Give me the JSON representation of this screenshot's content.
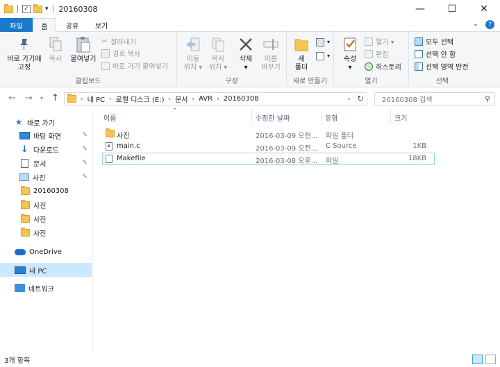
{
  "window": {
    "title": "20160308",
    "controls": [
      "—",
      "☐",
      "✕"
    ]
  },
  "tabs": {
    "file": "파일",
    "home": "홈",
    "share": "공유",
    "view": "보기"
  },
  "ribbon": {
    "clipboard": {
      "label": "클립보드",
      "pin_quick_access": "바로 가기에\n고정",
      "copy": "복사",
      "paste": "붙여넣기",
      "cut": "잘라내기",
      "copy_path": "경로 복사",
      "paste_shortcut": "바로 가기 붙여넣기"
    },
    "organize": {
      "label": "구성",
      "move_to": "이동\n위치 ▾",
      "copy_to": "복사\n위치 ▾",
      "delete": "삭제\n▾",
      "rename": "이름\n바꾸기"
    },
    "new": {
      "label": "새로 만들기",
      "new_folder": "새\n폴더"
    },
    "open": {
      "label": "열기",
      "properties": "속성\n▾",
      "open": "열기 ▾",
      "edit": "편집",
      "history": "히스토리"
    },
    "select": {
      "label": "선택",
      "select_all": "모두 선택",
      "select_none": "선택 안 함",
      "invert": "선택 영역 반전"
    }
  },
  "address": {
    "crumbs": [
      "내 PC",
      "로컬 디스크 (E:)",
      "문서",
      "AVR",
      "20160308"
    ],
    "search_placeholder": "20160308 검색"
  },
  "sidebar": {
    "quick_access": "바로 가기",
    "items": [
      {
        "label": "바탕 화면",
        "pinned": true
      },
      {
        "label": "다운로드",
        "pinned": true
      },
      {
        "label": "문서",
        "pinned": true
      },
      {
        "label": "사진",
        "pinned": true
      },
      {
        "label": "20160308",
        "pinned": false
      },
      {
        "label": "사진",
        "pinned": false
      },
      {
        "label": "사진",
        "pinned": false
      },
      {
        "label": "사진",
        "pinned": false
      }
    ],
    "onedrive": "OneDrive",
    "this_pc": "내 PC",
    "network": "네트워크"
  },
  "filelist": {
    "columns": {
      "name": "이름",
      "date": "수정한 날짜",
      "type": "유형",
      "size": "크기"
    },
    "rows": [
      {
        "name": "사진",
        "date": "2016-03-09 오전...",
        "type": "파일 폴더",
        "size": "",
        "icon": "folder-icon"
      },
      {
        "name": "main.c",
        "date": "2016-03-09 오전...",
        "type": "C Source",
        "size": "1KB",
        "icon": "c-source-icon"
      },
      {
        "name": "Makefile",
        "date": "2016-03-08 오후...",
        "type": "파일",
        "size": "18KB",
        "icon": "file-icon"
      }
    ]
  },
  "status": {
    "count": "3개 항목"
  }
}
